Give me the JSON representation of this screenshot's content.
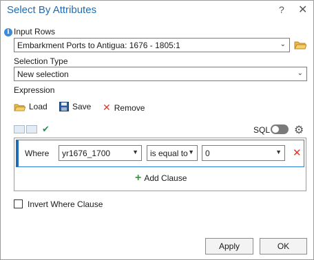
{
  "window": {
    "title": "Select By Attributes",
    "help": "?",
    "close": "✕"
  },
  "input_rows": {
    "label": "Input Rows",
    "value": "Embarkment Ports to Antigua: 1676 - 1805:1"
  },
  "selection_type": {
    "label": "Selection Type",
    "value": "New selection"
  },
  "expression": {
    "label": "Expression",
    "load": "Load",
    "save": "Save",
    "remove": "Remove",
    "sql": "SQL"
  },
  "clause": {
    "where": "Where",
    "field": "yr1676_1700",
    "operator": "is equal to",
    "value": "0",
    "add_clause": "Add Clause"
  },
  "invert": {
    "label": "Invert Where Clause"
  },
  "buttons": {
    "apply": "Apply",
    "ok": "OK"
  },
  "colors": {
    "accent": "#1f6bb5",
    "delete": "#d9382c",
    "add": "#3a9a3a"
  },
  "icons": [
    "info-icon",
    "folder-icon",
    "load-icon",
    "save-icon",
    "remove-icon",
    "check-icon",
    "gear-icon",
    "delete-clause-icon",
    "add-icon"
  ]
}
